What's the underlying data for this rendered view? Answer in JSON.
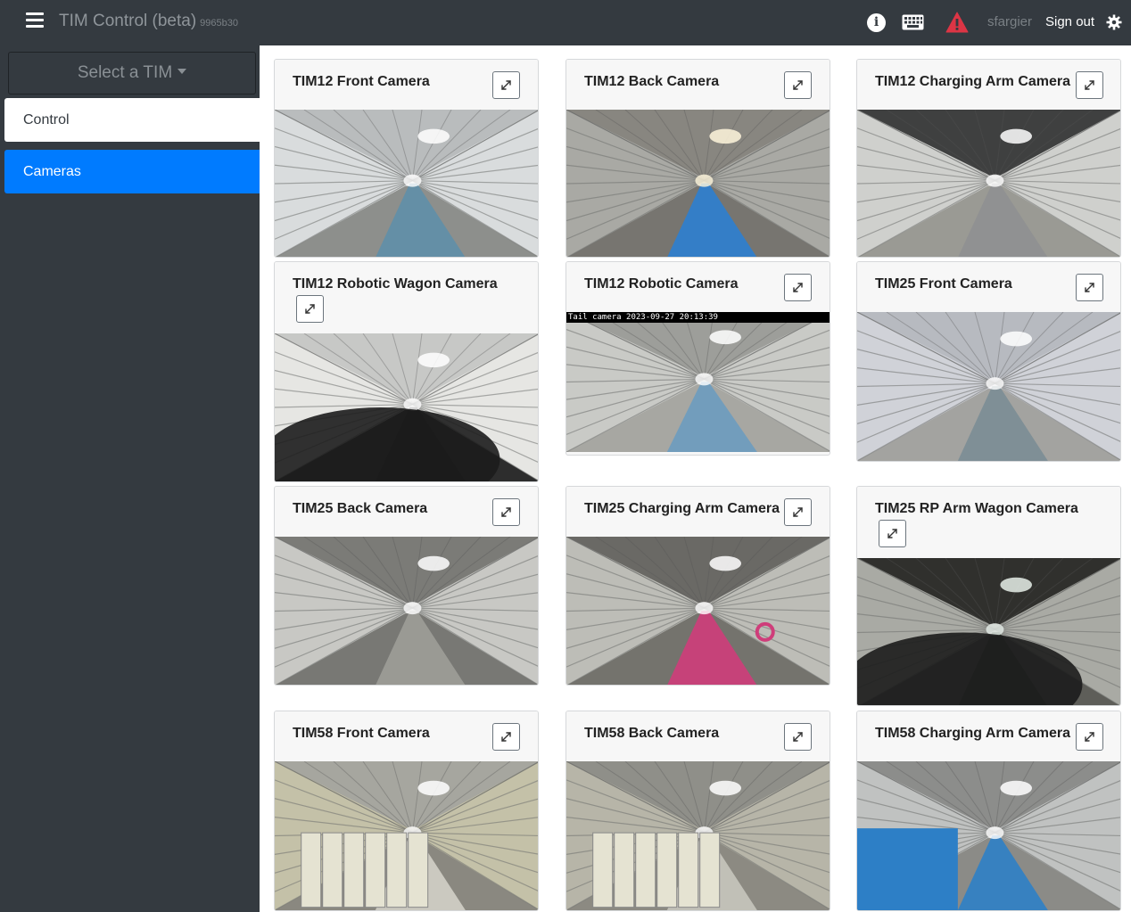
{
  "header": {
    "app_title": "TIM Control (beta)",
    "version": "9965b30",
    "username": "sfargier",
    "signout_label": "Sign out",
    "icons": [
      "menu-icon",
      "info-icon",
      "keyboard-icon",
      "alert-icon",
      "gear-icon"
    ],
    "alert_color": "#dc3545"
  },
  "sidebar": {
    "select_label": "Select a TIM",
    "items": [
      {
        "label": "Control",
        "active": false
      },
      {
        "label": "Cameras",
        "active": true
      }
    ],
    "active_color": "#007bff"
  },
  "cameras": [
    {
      "title": "TIM12 Front Camera"
    },
    {
      "title": "TIM12 Back Camera"
    },
    {
      "title": "TIM12 Charging Arm Camera"
    },
    {
      "title": "TIM12 Robotic Wagon Camera"
    },
    {
      "title": "TIM12 Robotic Camera",
      "overlay": "Tail camera 2023-09-27 20:13:39"
    },
    {
      "title": "TIM25 Front Camera"
    },
    {
      "title": "TIM25 Back Camera"
    },
    {
      "title": "TIM25 Charging Arm Camera"
    },
    {
      "title": "TIM25 RP Arm Wagon Camera"
    },
    {
      "title": "TIM58 Front Camera"
    },
    {
      "title": "TIM58 Back Camera"
    },
    {
      "title": "TIM58 Charging Arm Camera"
    }
  ]
}
